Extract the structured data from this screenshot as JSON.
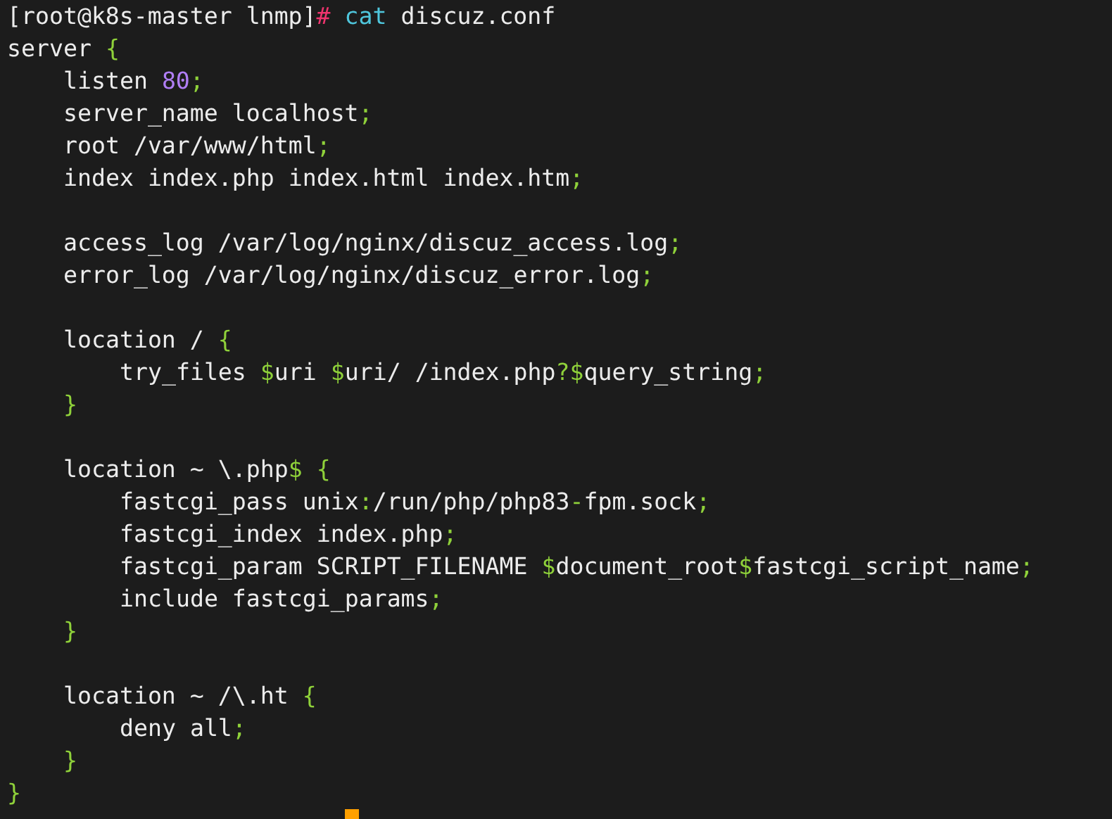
{
  "terminal": {
    "lines": [
      {
        "kind": "code",
        "segments": [
          {
            "text": "[root@k8s-master lnmp]",
            "kind": "plain"
          },
          {
            "text": "#",
            "kind": "prompt"
          },
          {
            "text": " cat",
            "kind": "command"
          },
          {
            "text": " discuz.conf",
            "kind": "plain"
          }
        ]
      },
      {
        "kind": "code",
        "segments": [
          {
            "text": "server ",
            "kind": "plain"
          },
          {
            "text": "{",
            "kind": "punct"
          }
        ],
        "children": [
          {
            "kind": "code",
            "segments": [
              {
                "text": "listen ",
                "kind": "plain"
              },
              {
                "text": "80",
                "kind": "number"
              },
              {
                "text": ";",
                "kind": "punct"
              }
            ]
          },
          {
            "kind": "code",
            "segments": [
              {
                "text": "server_name localhost",
                "kind": "plain"
              },
              {
                "text": ";",
                "kind": "punct"
              }
            ]
          },
          {
            "kind": "code",
            "segments": [
              {
                "text": "root /var/www/html",
                "kind": "plain"
              },
              {
                "text": ";",
                "kind": "punct"
              }
            ]
          },
          {
            "kind": "code",
            "segments": [
              {
                "text": "index index.php index.html index.htm",
                "kind": "plain"
              },
              {
                "text": ";",
                "kind": "punct"
              }
            ]
          },
          {
            "kind": "blank"
          },
          {
            "kind": "code",
            "segments": [
              {
                "text": "access_log /var/log/nginx/discuz_access.log",
                "kind": "plain"
              },
              {
                "text": ";",
                "kind": "punct"
              }
            ]
          },
          {
            "kind": "code",
            "segments": [
              {
                "text": "error_log /var/log/nginx/discuz_error.log",
                "kind": "plain"
              },
              {
                "text": ";",
                "kind": "punct"
              }
            ]
          },
          {
            "kind": "blank"
          },
          {
            "kind": "code",
            "segments": [
              {
                "text": "location / ",
                "kind": "plain"
              },
              {
                "text": "{",
                "kind": "punct"
              }
            ],
            "children": [
              {
                "kind": "code",
                "segments": [
                  {
                    "text": "try_files ",
                    "kind": "plain"
                  },
                  {
                    "text": "$",
                    "kind": "punct"
                  },
                  {
                    "text": "uri ",
                    "kind": "plain"
                  },
                  {
                    "text": "$",
                    "kind": "punct"
                  },
                  {
                    "text": "uri/ /index.php",
                    "kind": "plain"
                  },
                  {
                    "text": "?",
                    "kind": "punct"
                  },
                  {
                    "text": "$",
                    "kind": "punct"
                  },
                  {
                    "text": "query_string",
                    "kind": "plain"
                  },
                  {
                    "text": ";",
                    "kind": "punct"
                  }
                ]
              }
            ]
          },
          {
            "kind": "code",
            "segments": [
              {
                "text": "}",
                "kind": "punct"
              }
            ]
          },
          {
            "kind": "blank"
          },
          {
            "kind": "code",
            "segments": [
              {
                "text": "location ~ \\.php",
                "kind": "plain"
              },
              {
                "text": "$ {",
                "kind": "punct"
              }
            ],
            "children": [
              {
                "kind": "code",
                "segments": [
                  {
                    "text": "fastcgi_pass unix",
                    "kind": "plain"
                  },
                  {
                    "text": ":",
                    "kind": "punct"
                  },
                  {
                    "text": "/run/php/php83",
                    "kind": "plain"
                  },
                  {
                    "text": "-",
                    "kind": "punct"
                  },
                  {
                    "text": "fpm.sock",
                    "kind": "plain"
                  },
                  {
                    "text": ";",
                    "kind": "punct"
                  }
                ]
              },
              {
                "kind": "code",
                "segments": [
                  {
                    "text": "fastcgi_index index.php",
                    "kind": "plain"
                  },
                  {
                    "text": ";",
                    "kind": "punct"
                  }
                ]
              },
              {
                "kind": "code",
                "segments": [
                  {
                    "text": "fastcgi_param SCRIPT_FILENAME ",
                    "kind": "plain"
                  },
                  {
                    "text": "$",
                    "kind": "punct"
                  },
                  {
                    "text": "document_root",
                    "kind": "plain"
                  },
                  {
                    "text": "$",
                    "kind": "punct"
                  },
                  {
                    "text": "fastcgi_script_name",
                    "kind": "plain"
                  },
                  {
                    "text": ";",
                    "kind": "punct"
                  }
                ]
              },
              {
                "kind": "code",
                "segments": [
                  {
                    "text": "include fastcgi_params",
                    "kind": "plain"
                  },
                  {
                    "text": ";",
                    "kind": "punct"
                  }
                ]
              }
            ]
          },
          {
            "kind": "code",
            "segments": [
              {
                "text": "}",
                "kind": "punct"
              }
            ]
          },
          {
            "kind": "blank"
          },
          {
            "kind": "code",
            "segments": [
              {
                "text": "location ~ /\\.ht ",
                "kind": "plain"
              },
              {
                "text": "{",
                "kind": "punct"
              }
            ],
            "children": [
              {
                "kind": "code",
                "segments": [
                  {
                    "text": "deny all",
                    "kind": "plain"
                  },
                  {
                    "text": ";",
                    "kind": "punct"
                  }
                ]
              }
            ]
          },
          {
            "kind": "code",
            "segments": [
              {
                "text": "}",
                "kind": "punct"
              }
            ]
          }
        ]
      },
      {
        "kind": "code",
        "segments": [
          {
            "text": "}",
            "kind": "punct"
          }
        ]
      }
    ]
  }
}
